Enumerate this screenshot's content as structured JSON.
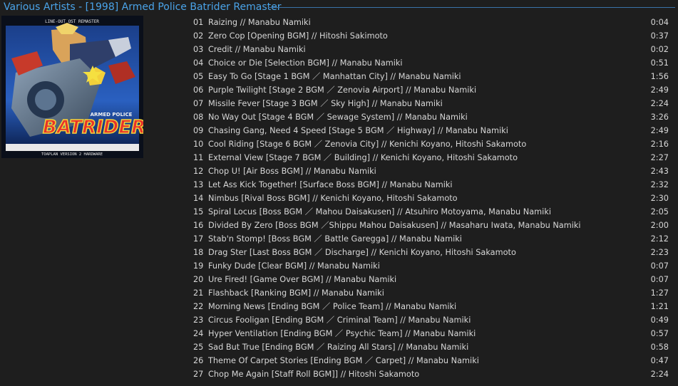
{
  "header": {
    "title": "Various Artists - [1998] Armed Police Batrider Remaster",
    "accent": "#4aa3e8"
  },
  "cover": {
    "top_text": "LINE-OUT OST REMASTER",
    "logo_small": "ARMED POLICE",
    "logo_text": "BATRIDER",
    "bottom_text": "TOAPLAN VERSION 2 HARDWARE"
  },
  "tracks": [
    {
      "no": "01",
      "title": "Raizing // Manabu Namiki",
      "dur": "0:04"
    },
    {
      "no": "02",
      "title": "Zero Cop [Opening BGM] // Hitoshi Sakimoto",
      "dur": "0:37"
    },
    {
      "no": "03",
      "title": "Credit // Manabu Namiki",
      "dur": "0:02"
    },
    {
      "no": "04",
      "title": "Choice or Die [Selection BGM] // Manabu Namiki",
      "dur": "0:51"
    },
    {
      "no": "05",
      "title": "Easy To Go [Stage 1 BGM ／ Manhattan City] // Manabu Namiki",
      "dur": "1:56"
    },
    {
      "no": "06",
      "title": "Purple Twilight [Stage 2 BGM ／ Zenovia Airport] // Manabu Namiki",
      "dur": "2:49"
    },
    {
      "no": "07",
      "title": "Missile Fever [Stage 3 BGM ／ Sky High] // Manabu Namiki",
      "dur": "2:24"
    },
    {
      "no": "08",
      "title": "No Way Out [Stage 4 BGM ／ Sewage System] // Manabu Namiki",
      "dur": "3:26"
    },
    {
      "no": "09",
      "title": "Chasing Gang, Need 4 Speed [Stage 5 BGM ／ Highway] // Manabu Namiki",
      "dur": "2:49"
    },
    {
      "no": "10",
      "title": "Cool Riding [Stage 6 BGM ／ Zenovia City] // Kenichi Koyano, Hitoshi Sakamoto",
      "dur": "2:16"
    },
    {
      "no": "11",
      "title": "External View [Stage 7 BGM ／ Building] // Kenichi Koyano, Hitoshi Sakamoto",
      "dur": "2:27"
    },
    {
      "no": "12",
      "title": "Chop U! [Air Boss BGM] // Manabu Namiki",
      "dur": "2:43"
    },
    {
      "no": "13",
      "title": "Let Ass Kick Together! [Surface Boss BGM] // Manabu Namiki",
      "dur": "2:32"
    },
    {
      "no": "14",
      "title": "Nimbus [Rival Boss BGM] // Kenichi Koyano, Hitoshi Sakamoto",
      "dur": "2:30"
    },
    {
      "no": "15",
      "title": "Spiral Locus [Boss BGM ／ Mahou Daisakusen] // Atsuhiro Motoyama, Manabu Namiki",
      "dur": "2:05"
    },
    {
      "no": "16",
      "title": "Divided By Zero [Boss BGM ／Shippu Mahou Daisakusen] // Masaharu Iwata, Manabu Namiki",
      "dur": "2:00"
    },
    {
      "no": "17",
      "title": "Stab'n Stomp! [Boss BGM ／ Battle Garegga] // Manabu Namiki",
      "dur": "2:12"
    },
    {
      "no": "18",
      "title": "Drag Ster [Last Boss BGM ／ Discharge] // Kenichi Koyano, Hitoshi Sakamoto",
      "dur": "2:23"
    },
    {
      "no": "19",
      "title": "Funky Dude [Clear BGM] // Manabu Namiki",
      "dur": "0:07"
    },
    {
      "no": "20",
      "title": "Ure Fired! [Game Over BGM] // Manabu Namiki",
      "dur": "0:07"
    },
    {
      "no": "21",
      "title": "Flashback [Ranking BGM] // Manabu Namiki",
      "dur": "1:27"
    },
    {
      "no": "22",
      "title": "Morning News [Ending BGM ／ Police Team] // Manabu Namiki",
      "dur": "1:21"
    },
    {
      "no": "23",
      "title": "Circus Fooligan [Ending BGM ／ Criminal Team] // Manabu Namiki",
      "dur": "0:49"
    },
    {
      "no": "24",
      "title": "Hyper Ventilation [Ending BGM ／ Psychic Team] // Manabu Namiki",
      "dur": "0:57"
    },
    {
      "no": "25",
      "title": "Sad But True [Ending BGM ／ Raizing All Stars] // Manabu Namiki",
      "dur": "0:58"
    },
    {
      "no": "26",
      "title": "Theme Of Carpet Stories [Ending BGM ／ Carpet] // Manabu Namiki",
      "dur": "0:47"
    },
    {
      "no": "27",
      "title": "Chop Me Again [Staff Roll BGM]] // Hitoshi Sakamoto",
      "dur": "2:24"
    }
  ]
}
